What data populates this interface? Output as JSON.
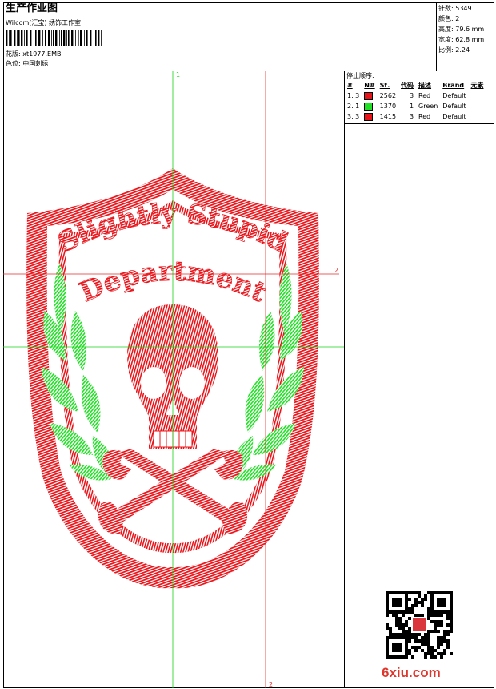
{
  "header": {
    "title": "生产作业图",
    "software": "Wilcom(汇宝) 绣饰工作室",
    "design_label": "花版:",
    "design_value": "xt1977.EMB",
    "color_label": "色位:",
    "color_value": "中国刺绣"
  },
  "stats": [
    {
      "label": "针数:",
      "value": "5349"
    },
    {
      "label": "颜色:",
      "value": "2"
    },
    {
      "label": "高度:",
      "value": "79.6 mm"
    },
    {
      "label": "宽度:",
      "value": "62.8 mm"
    },
    {
      "label": "比例:",
      "value": "2.24"
    }
  ],
  "stop_sequence": {
    "label": "停止顺序:",
    "columns": [
      "#",
      "N#",
      "St.",
      "代码",
      "描述",
      "Brand",
      "元素"
    ],
    "rows": [
      {
        "seq": "1. 3",
        "stitches": "2562",
        "code": "3",
        "desc": "Red",
        "brand": "Default",
        "color": "#e8141a"
      },
      {
        "seq": "2. 1",
        "stitches": "1370",
        "code": "1",
        "desc": "Green",
        "brand": "Default",
        "color": "#1fe023"
      },
      {
        "seq": "3. 3",
        "stitches": "1415",
        "code": "3",
        "desc": "Red",
        "brand": "Default",
        "color": "#e8141a"
      }
    ]
  },
  "design": {
    "guide_labels": [
      "1",
      "2",
      "2"
    ],
    "text_line1": "Slightly Stupid",
    "text_line2": "Department",
    "thread_red": "#e8141a",
    "thread_green": "#1fe023",
    "guide_green": "#19d219",
    "guide_red": "#e82a2a"
  },
  "watermark": "6xiu.com"
}
